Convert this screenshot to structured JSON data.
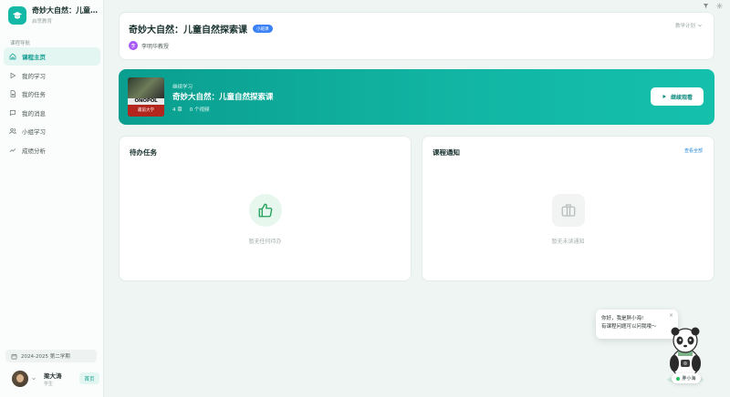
{
  "brand": {
    "title": "奇妙大自然：儿童自然探索课",
    "subtitle": "启思教育"
  },
  "nav": {
    "heading": "课程导航",
    "items": [
      {
        "label": "课程主页",
        "icon": "home-icon",
        "active": true
      },
      {
        "label": "我的学习",
        "icon": "play-icon",
        "active": false
      },
      {
        "label": "我的任务",
        "icon": "document-icon",
        "active": false
      },
      {
        "label": "我的消息",
        "icon": "message-icon",
        "active": false
      },
      {
        "label": "小组学习",
        "icon": "group-icon",
        "active": false
      },
      {
        "label": "成绩分析",
        "icon": "chart-icon",
        "active": false
      }
    ]
  },
  "term": "2024-2025 第二学期",
  "user": {
    "name": "梁大涛",
    "role": "学生",
    "home_button": "首页"
  },
  "course": {
    "title": "奇妙大自然：儿童自然探索课",
    "badge": "小班课",
    "teacher_initial": "李",
    "teacher": "李明华教授",
    "plan_label": "教学计划"
  },
  "banner": {
    "kicker": "继续学习",
    "title": "奇妙大自然：儿童自然探索课",
    "chapters": "4 章",
    "videos": "0 个视频",
    "cover_text": "ONOPOL",
    "cover_sub": "最前大学",
    "button": "继续观看"
  },
  "todo": {
    "title": "待办任务",
    "empty": "暂无任何待办"
  },
  "notice": {
    "title": "课程通知",
    "view_all": "查看全部",
    "empty": "暂无未读通知"
  },
  "assistant": {
    "greeting": "你好，我是胖小海!",
    "prompt": "有课程问题可以问我哦～",
    "close": "×",
    "name": "胖小海"
  },
  "colors": {
    "accent": "#14b8a6",
    "badge": "#3b82f6",
    "teacher_avatar": "#a855f7"
  }
}
